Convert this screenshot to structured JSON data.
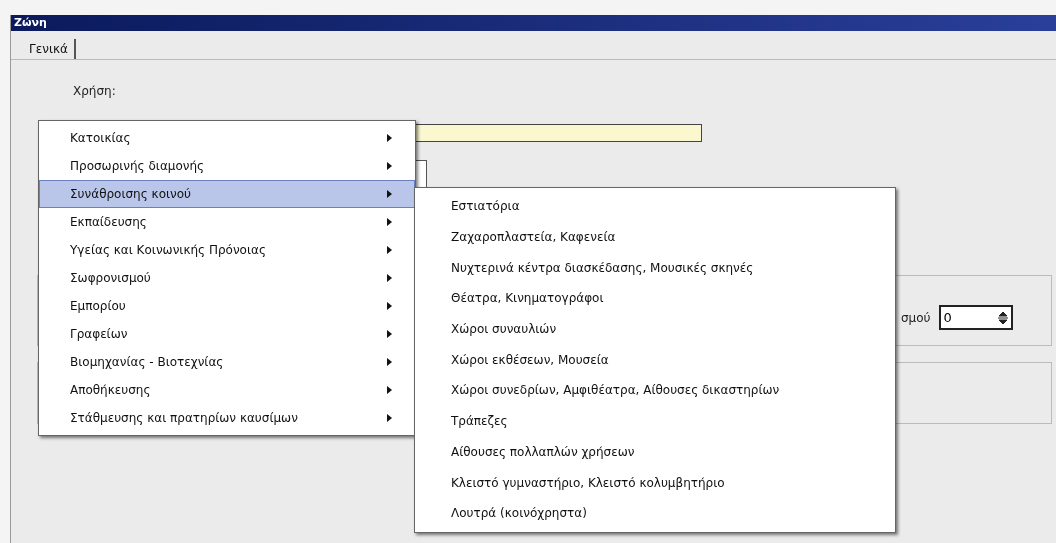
{
  "window": {
    "title": "Ζώνη"
  },
  "tabs": [
    {
      "label": "Γενικά",
      "selected": true
    }
  ],
  "use_field": {
    "label": "Χρήση:"
  },
  "count_field": {
    "label": "σμού",
    "value": "0"
  },
  "menu": {
    "items": [
      {
        "label": "Κατοικίας",
        "selected": false,
        "has_submenu": true
      },
      {
        "label": "Προσωρινής διαμονής",
        "selected": false,
        "has_submenu": true
      },
      {
        "label": "Συνάθροισης κοινού",
        "selected": true,
        "has_submenu": true
      },
      {
        "label": "Εκπαίδευσης",
        "selected": false,
        "has_submenu": true
      },
      {
        "label": "Υγείας και Κοινωνικής Πρόνοιας",
        "selected": false,
        "has_submenu": true
      },
      {
        "label": "Σωφρονισμού",
        "selected": false,
        "has_submenu": true
      },
      {
        "label": "Εμπορίου",
        "selected": false,
        "has_submenu": true
      },
      {
        "label": "Γραφείων",
        "selected": false,
        "has_submenu": true
      },
      {
        "label": "Βιομηχανίας - Βιοτεχνίας",
        "selected": false,
        "has_submenu": true
      },
      {
        "label": "Αποθήκευσης",
        "selected": false,
        "has_submenu": true
      },
      {
        "label": "Στάθμευσης και πρατηρίων καυσίμων",
        "selected": false,
        "has_submenu": true
      }
    ]
  },
  "submenu": {
    "items": [
      {
        "label": "Εστιατόρια"
      },
      {
        "label": "Ζαχαροπλαστεία, Καφενεία"
      },
      {
        "label": "Νυχτερινά κέντρα διασκέδασης, Μουσικές σκηνές"
      },
      {
        "label": "Θέατρα, Κινηματογράφοι"
      },
      {
        "label": "Χώροι συναυλιών"
      },
      {
        "label": "Χώροι εκθέσεων, Μουσεία"
      },
      {
        "label": "Χώροι συνεδρίων, Αμφιθέατρα, Αίθουσες δικαστηρίων"
      },
      {
        "label": "Τράπεζες"
      },
      {
        "label": "Αίθουσες πολλαπλών χρήσεων"
      },
      {
        "label": "Κλειστό γυμναστήριο, Κλειστό κολυμβητήριο"
      },
      {
        "label": "Λουτρά (κοινόχρηστα)"
      }
    ]
  }
}
